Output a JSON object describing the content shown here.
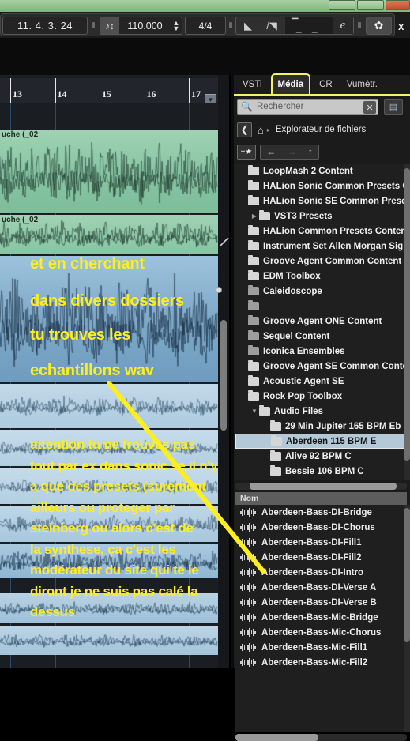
{
  "window": {
    "buttons": [
      {
        "name": "minimize",
        "label": ""
      },
      {
        "name": "maximize",
        "label": ""
      },
      {
        "name": "close",
        "label": ""
      }
    ]
  },
  "transport": {
    "position_value": "11. 4. 3. 24",
    "tempo_icon": "♪↕",
    "tempo_value": "110.000",
    "time_signature": "4/4",
    "click_icon": "◣",
    "precount_icon": "/◥",
    "count_top": "▔",
    "count_bottom": "_ _ _",
    "editor_label": "e",
    "gear_icon": "✿",
    "x_label": "X"
  },
  "ruler": {
    "bars": [
      "13",
      "14",
      "15",
      "16",
      "17"
    ],
    "menu_icon": "▼"
  },
  "arrange": {
    "clips": [
      {
        "name": "uche (_02",
        "color": "green"
      },
      {
        "name": "uche (_02",
        "color": "green"
      },
      {
        "name": "",
        "color": "blue"
      },
      {
        "name": "",
        "color": "blue"
      },
      {
        "name": "",
        "color": "blue"
      },
      {
        "name": "",
        "color": "blue"
      },
      {
        "name": "",
        "color": "blue"
      },
      {
        "name": "",
        "color": "blue"
      },
      {
        "name": "",
        "color": "blue"
      },
      {
        "name": "",
        "color": "blue"
      }
    ]
  },
  "media": {
    "tabs": [
      {
        "label": "VSTi",
        "active": false
      },
      {
        "label": "Média",
        "active": true
      },
      {
        "label": "CR",
        "active": false
      },
      {
        "label": "Vumètr.",
        "active": false
      }
    ],
    "search": {
      "placeholder": "Rechercher",
      "icon": "search-icon",
      "clear_icon": "✕",
      "view_icon": "▤"
    },
    "breadcrumb": {
      "back_icon": "❮",
      "home_icon": "⌂",
      "separator": "▸",
      "text": "Explorateur de fichiers"
    },
    "nav": {
      "favorite_icon": "+★",
      "back_icon": "←",
      "forward_icon": "→",
      "up_icon": "↑"
    },
    "tree": [
      {
        "label": "LoopMash 2 Content",
        "indent": 0,
        "expand": "",
        "selected": false,
        "dim": false
      },
      {
        "label": "HALion Sonic Common Presets Con",
        "indent": 0,
        "expand": "",
        "selected": false,
        "dim": false
      },
      {
        "label": "HALion Sonic SE Common Presets C",
        "indent": 0,
        "expand": "",
        "selected": false,
        "dim": false
      },
      {
        "label": "VST3 Presets",
        "indent": 1,
        "expand": "▶",
        "selected": false,
        "dim": false
      },
      {
        "label": "HALion Common Presets Content",
        "indent": 0,
        "expand": "",
        "selected": false,
        "dim": false
      },
      {
        "label": "Instrument Set Allen Morgan Signa",
        "indent": 0,
        "expand": "",
        "selected": false,
        "dim": false
      },
      {
        "label": "Groove Agent Common Content",
        "indent": 0,
        "expand": "",
        "selected": false,
        "dim": false
      },
      {
        "label": "EDM Toolbox",
        "indent": 0,
        "expand": "",
        "selected": false,
        "dim": false
      },
      {
        "label": "Caleidoscope",
        "indent": 0,
        "expand": "",
        "selected": false,
        "dim": true
      },
      {
        "label": "",
        "indent": 0,
        "expand": "",
        "selected": false,
        "dim": true
      },
      {
        "label": "Groove Agent ONE Content",
        "indent": 0,
        "expand": "",
        "selected": false,
        "dim": true
      },
      {
        "label": "Sequel Content",
        "indent": 0,
        "expand": "",
        "selected": false,
        "dim": true
      },
      {
        "label": "Iconica Ensembles",
        "indent": 0,
        "expand": "",
        "selected": false,
        "dim": true
      },
      {
        "label": "Groove Agent SE Common Content",
        "indent": 0,
        "expand": "",
        "selected": false,
        "dim": false
      },
      {
        "label": "Acoustic Agent SE",
        "indent": 0,
        "expand": "",
        "selected": false,
        "dim": false
      },
      {
        "label": "Rock Pop Toolbox",
        "indent": 0,
        "expand": "",
        "selected": false,
        "dim": false
      },
      {
        "label": "Audio Files",
        "indent": 1,
        "expand": "▼",
        "selected": false,
        "dim": false
      },
      {
        "label": "29 Min Jupiter 165 BPM Eb",
        "indent": 2,
        "expand": "",
        "selected": false,
        "dim": false
      },
      {
        "label": "Aberdeen 115 BPM E",
        "indent": 2,
        "expand": "",
        "selected": true,
        "dim": false
      },
      {
        "label": "Alive 92 BPM C",
        "indent": 2,
        "expand": "",
        "selected": false,
        "dim": false
      },
      {
        "label": "Bessie 106 BPM C",
        "indent": 2,
        "expand": "",
        "selected": false,
        "dim": false
      }
    ],
    "list_header": "Nom",
    "files": [
      {
        "label": "Aberdeen-Bass-DI-Bridge"
      },
      {
        "label": "Aberdeen-Bass-DI-Chorus"
      },
      {
        "label": "Aberdeen-Bass-DI-Fill1"
      },
      {
        "label": "Aberdeen-Bass-DI-Fill2"
      },
      {
        "label": "Aberdeen-Bass-DI-Intro"
      },
      {
        "label": "Aberdeen-Bass-DI-Verse A"
      },
      {
        "label": "Aberdeen-Bass-DI-Verse B"
      },
      {
        "label": "Aberdeen-Bass-Mic-Bridge"
      },
      {
        "label": "Aberdeen-Bass-Mic-Chorus"
      },
      {
        "label": "Aberdeen-Bass-Mic-Fill1"
      },
      {
        "label": "Aberdeen-Bass-Mic-Fill2"
      }
    ]
  },
  "annotation": {
    "lines": [
      "et en cherchant",
      "dans divers dossiers",
      "tu trouves les",
      "echantillons wav"
    ],
    "paragraph": [
      "attention tu ne trouves pas",
      "tout par ex dans sonic se il n'y",
      "a que des presets (surement",
      "ailleurs ou proteger par",
      "steinberg ou alors c'est de",
      "la synthese, ça c'est les",
      "modérateur du site qui te le",
      "diront je ne suis pas calé la",
      "dessus"
    ]
  },
  "colors": {
    "accent_yellow": "#fcee21",
    "tab_highlight": "#f5f06a",
    "selection_blue": "#b4c9d8",
    "clip_green": "#87c5a3",
    "clip_blue": "#7fa9c9"
  }
}
